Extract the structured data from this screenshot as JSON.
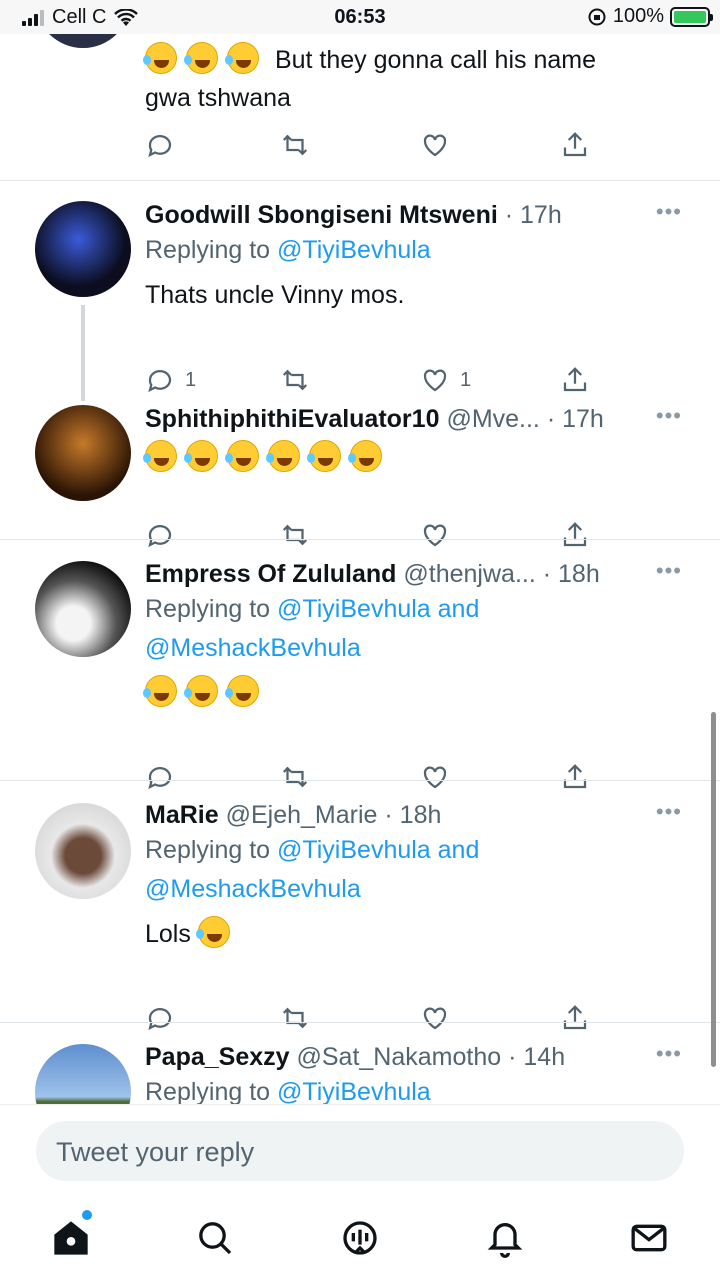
{
  "status": {
    "carrier": "Cell C",
    "time": "06:53",
    "battery": "100%"
  },
  "tweets": [
    {
      "id": "t0",
      "text_line1": "But they gonna call his name",
      "text_line2": "gwa tshwana",
      "emoji_count": 3
    },
    {
      "id": "t1",
      "name": "Goodwill Sbongiseni Mtsweni",
      "handle": "",
      "time": "· 17h",
      "reply_prefix": "Replying to ",
      "reply_to": "@TiyiBevhula",
      "reply_to2": "",
      "text": "Thats uncle Vinny mos.",
      "replies": "1",
      "likes": "1",
      "avatar_color": "#1b1f3a"
    },
    {
      "id": "t2",
      "name": "SphithiphithiEvaluator10",
      "handle": "@Mve...",
      "time": "· 17h",
      "emoji_count": 6,
      "avatar_color": "#6b3a10"
    },
    {
      "id": "t3",
      "name": "Empress Of Zululand",
      "handle": "@thenjwa...",
      "time": "· 18h",
      "reply_prefix": "Replying to ",
      "reply_to": "@TiyiBevhula and",
      "reply_to2": "@MeshackBevhula",
      "emoji_count": 3,
      "avatar_color": "#222"
    },
    {
      "id": "t4",
      "name": "MaRie",
      "handle": "@Ejeh_Marie",
      "time": "· 18h",
      "reply_prefix": "Replying to ",
      "reply_to": "@TiyiBevhula and",
      "reply_to2": "@MeshackBevhula",
      "text": "Lols",
      "avatar_color": "#cfcfcf"
    },
    {
      "id": "t5",
      "name": "Papa_Sexzy",
      "handle": "@Sat_Nakamotho",
      "time": "· 14h",
      "reply_prefix": "Replying to ",
      "reply_to": "@TiyiBevhula",
      "avatar_color": "#4a7bbd"
    }
  ],
  "more_icon": "more-icon",
  "reply_bar": {
    "placeholder": "Tweet your reply"
  },
  "tabs": [
    "home-icon",
    "search-icon",
    "spaces-icon",
    "notifications-icon",
    "messages-icon"
  ],
  "colors": {
    "accent": "#1d9bf0",
    "muted": "#536471"
  }
}
